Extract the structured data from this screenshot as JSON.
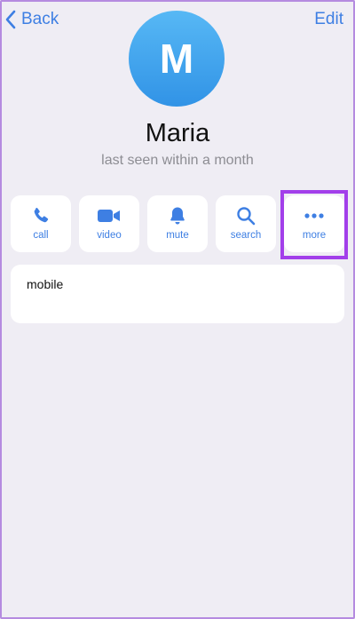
{
  "nav": {
    "back_label": "Back",
    "edit_label": "Edit"
  },
  "profile": {
    "avatar_initial": "M",
    "name": "Maria",
    "status": "last seen within a month"
  },
  "actions": [
    {
      "label": "call",
      "icon": "phone-icon"
    },
    {
      "label": "video",
      "icon": "video-camera-icon"
    },
    {
      "label": "mute",
      "icon": "bell-icon"
    },
    {
      "label": "search",
      "icon": "magnifier-icon"
    },
    {
      "label": "more",
      "icon": "ellipsis-icon"
    }
  ],
  "info": {
    "phone_label": "mobile"
  },
  "colors": {
    "accent": "#3e7fe3",
    "background": "#efedf4",
    "highlight": "#a23fea",
    "avatar_top": "#57b8f5",
    "avatar_bottom": "#3193e6"
  }
}
